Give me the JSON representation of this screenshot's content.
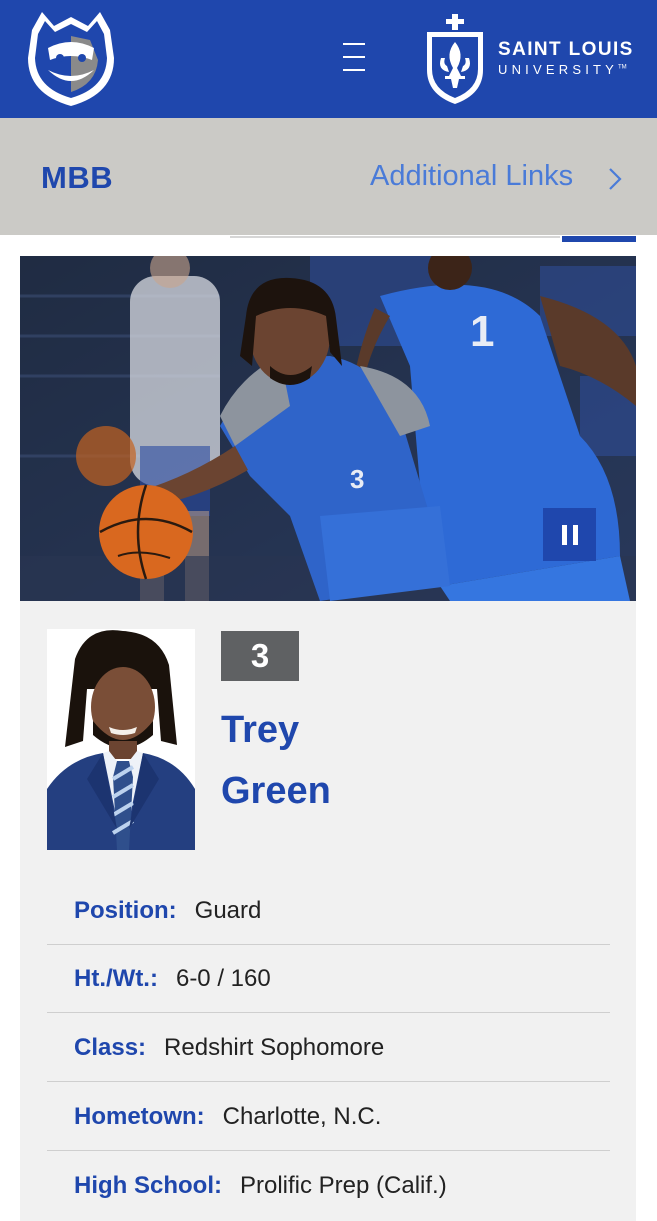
{
  "header": {
    "school_line1": "SAINT LOUIS",
    "school_line2": "UNIVERSITY",
    "tm": "TM",
    "menu_icon": "hamburger-menu-icon",
    "brand_color": "#1f47ad"
  },
  "subnav": {
    "title": "MBB",
    "links_label": "Additional Links",
    "chevron_icon": "chevron-right-icon"
  },
  "hero": {
    "pause_icon": "pause-icon",
    "jersey_left": "3",
    "jersey_right": "1"
  },
  "player": {
    "number": "3",
    "first_name": "Trey",
    "last_name": "Green"
  },
  "bio": [
    {
      "label": "Position:",
      "value": "Guard"
    },
    {
      "label": "Ht./Wt.:",
      "value": "6-0 / 160"
    },
    {
      "label": "Class:",
      "value": "Redshirt Sophomore"
    },
    {
      "label": "Hometown:",
      "value": "Charlotte, N.C."
    },
    {
      "label": "High School:",
      "value": "Prolific Prep (Calif.)"
    }
  ],
  "colors": {
    "primary": "#1f47ad",
    "link": "#4a7bd8",
    "subnav_bg": "#cbcac6",
    "card_bg": "#f1f1f1"
  }
}
